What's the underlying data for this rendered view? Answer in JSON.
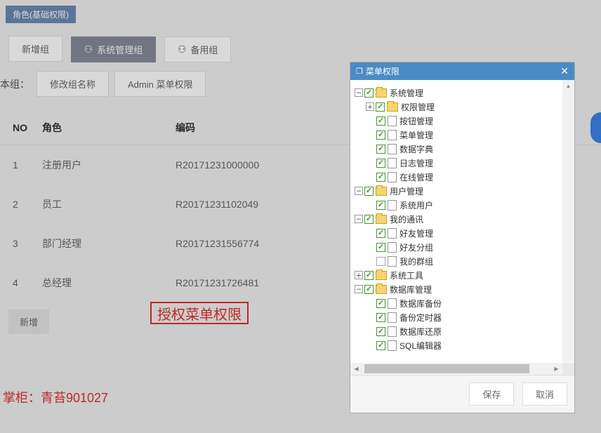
{
  "tag": "角色(基础权限)",
  "toolbar": {
    "newGroup": "新增组",
    "systemGroup": "系统管理组",
    "backupGroup": "备用组"
  },
  "subtoolbar": {
    "label": "本组：",
    "rename": "修改组名称",
    "adminMenu": "Admin 菜单权限"
  },
  "table": {
    "headers": {
      "no": "NO",
      "role": "角色",
      "code": "编码"
    },
    "rows": [
      {
        "no": "1",
        "role": "注册用户",
        "code": "R20171231000000"
      },
      {
        "no": "2",
        "role": "员工",
        "code": "R20171231102049"
      },
      {
        "no": "3",
        "role": "部门经理",
        "code": "R20171231556774"
      },
      {
        "no": "4",
        "role": "总经理",
        "code": "R20171231726481"
      }
    ]
  },
  "addBtn": "新增",
  "highlight": "授权菜单权限",
  "footer": "掌柜：青苔901027",
  "dialog": {
    "title": "菜单权限",
    "save": "保存",
    "cancel": "取消",
    "tree": {
      "sysMgmt": "系统管理",
      "permMgmt": "权限管理",
      "btnMgmt": "按钮管理",
      "menuMgmt": "菜单管理",
      "dataDict": "数据字典",
      "logMgmt": "日志管理",
      "online": "在线管理",
      "userMgmt": "用户管理",
      "sysUser": "系统用户",
      "myComm": "我的通讯",
      "friendMgmt": "好友管理",
      "friendGroup": "好友分组",
      "myGroup": "我的群组",
      "sysTool": "系统工具",
      "dbMgmt": "数据库管理",
      "dbBackup": "数据库备份",
      "backupTimer": "备份定时器",
      "dbRestore": "数据库还原",
      "sqlEditor": "SQL编辑器"
    }
  }
}
